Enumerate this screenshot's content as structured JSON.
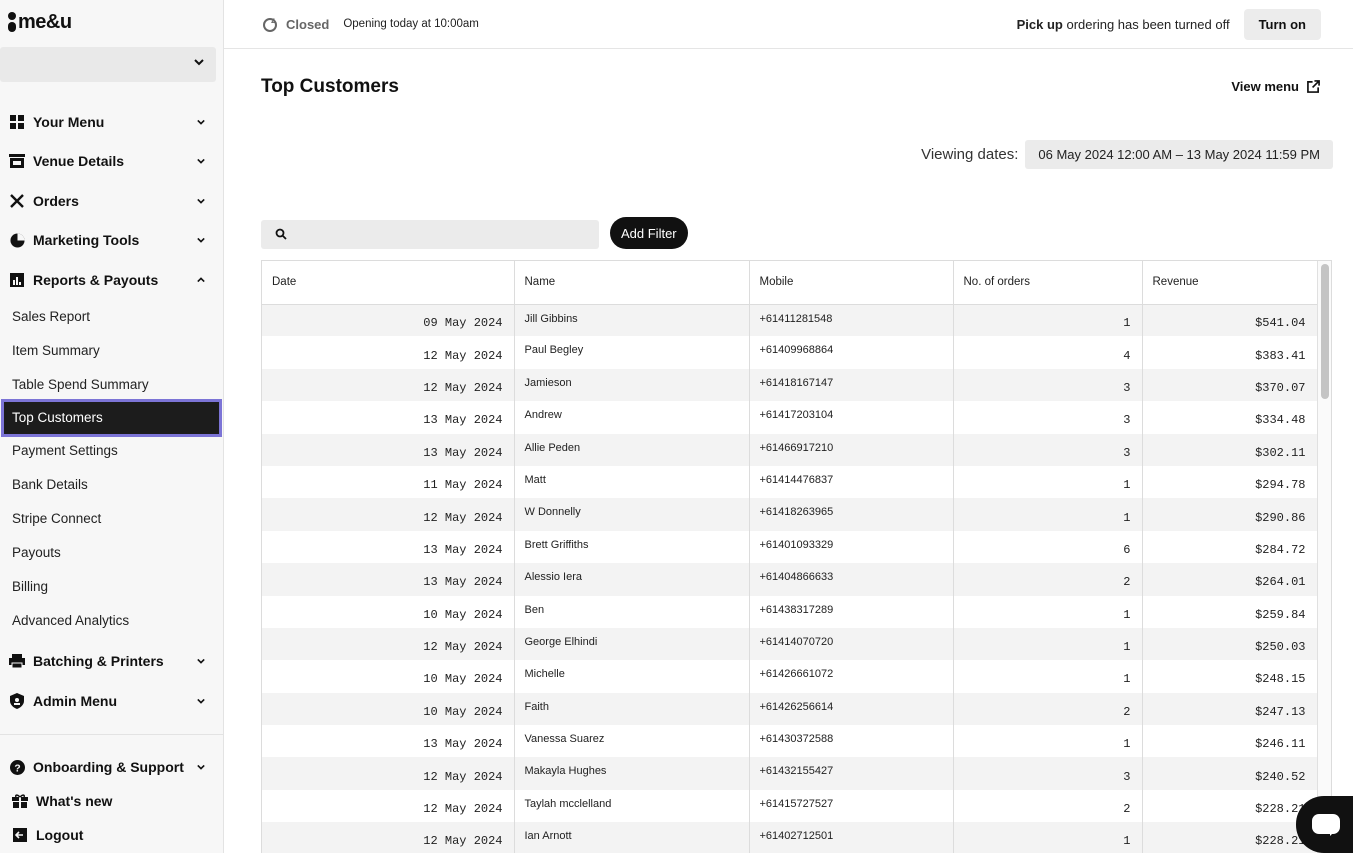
{
  "brand": {
    "name": "me&u"
  },
  "venue_select": {
    "value": ""
  },
  "sidebar": {
    "groups": [
      {
        "label": "Your Menu",
        "icon": "grid-icon"
      },
      {
        "label": "Venue Details",
        "icon": "store-icon"
      },
      {
        "label": "Orders",
        "icon": "utensils-icon"
      },
      {
        "label": "Marketing Tools",
        "icon": "pie-chart-icon"
      },
      {
        "label": "Reports & Payouts",
        "icon": "bar-chart-icon",
        "expanded": true
      }
    ],
    "sub_items": [
      "Sales Report",
      "Item Summary",
      "Table Spend Summary",
      "Top Customers",
      "Payment Settings",
      "Bank Details",
      "Stripe Connect",
      "Payouts",
      "Billing",
      "Advanced Analytics"
    ],
    "active_sub": "Top Customers",
    "groups_after": [
      {
        "label": "Batching & Printers",
        "icon": "printer-icon"
      },
      {
        "label": "Admin Menu",
        "icon": "shield-user-icon"
      }
    ],
    "bottom": [
      {
        "label": "Onboarding & Support",
        "icon": "help-icon"
      },
      {
        "label": "What's new",
        "icon": "gift-icon"
      },
      {
        "label": "Logout",
        "icon": "logout-icon"
      }
    ]
  },
  "topbar": {
    "status": "Closed",
    "opening": "Opening today at 10:00am",
    "pickup_bold": "Pick up",
    "pickup_rest": " ordering has been turned off",
    "turn_on": "Turn on"
  },
  "page": {
    "title": "Top Customers",
    "view_menu": "View menu",
    "viewing_label": "Viewing dates:",
    "viewing_value": "06 May 2024 12:00 AM – 13 May 2024 11:59 PM",
    "search_placeholder": "",
    "add_filter": "Add Filter"
  },
  "table": {
    "columns": [
      "Date",
      "Name",
      "Mobile",
      "No. of orders",
      "Revenue"
    ],
    "rows": [
      [
        "09 May 2024",
        "Jill Gibbins",
        "+61411281548",
        "1",
        "$541.04"
      ],
      [
        "12 May 2024",
        "Paul Begley",
        "+61409968864",
        "4",
        "$383.41"
      ],
      [
        "12 May 2024",
        "Jamieson",
        "+61418167147",
        "3",
        "$370.07"
      ],
      [
        "13 May 2024",
        "Andrew",
        "+61417203104",
        "3",
        "$334.48"
      ],
      [
        "13 May 2024",
        "Allie Peden",
        "+61466917210",
        "3",
        "$302.11"
      ],
      [
        "11 May 2024",
        "Matt",
        "+61414476837",
        "1",
        "$294.78"
      ],
      [
        "12 May 2024",
        "W Donnelly",
        "+61418263965",
        "1",
        "$290.86"
      ],
      [
        "13 May 2024",
        "Brett Griffiths",
        "+61401093329",
        "6",
        "$284.72"
      ],
      [
        "13 May 2024",
        "Alessio Iera",
        "+61404866633",
        "2",
        "$264.01"
      ],
      [
        "10 May 2024",
        "Ben",
        "+61438317289",
        "1",
        "$259.84"
      ],
      [
        "12 May 2024",
        "George Elhindi",
        "+61414070720",
        "1",
        "$250.03"
      ],
      [
        "10 May 2024",
        "Michelle",
        "+61426661072",
        "1",
        "$248.15"
      ],
      [
        "10 May 2024",
        "Faith",
        "+61426256614",
        "2",
        "$247.13"
      ],
      [
        "13 May 2024",
        "Vanessa Suarez",
        "+61430372588",
        "1",
        "$246.11"
      ],
      [
        "12 May 2024",
        "Makayla Hughes",
        "+61432155427",
        "3",
        "$240.52"
      ],
      [
        "12 May 2024",
        "Taylah mcclelland",
        "+61415727527",
        "2",
        "$228.21"
      ],
      [
        "12 May 2024",
        "Ian Arnott",
        "+61402712501",
        "1",
        "$228.21"
      ]
    ]
  },
  "colors": {
    "active_outline": "#7c74d6",
    "active_bg": "#1c1c1c"
  }
}
